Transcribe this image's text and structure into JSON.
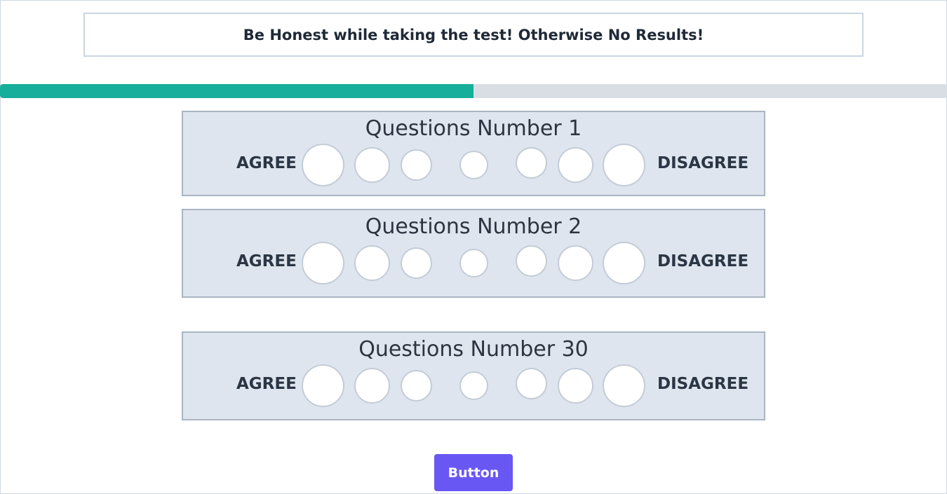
{
  "notice": {
    "text": "Be Honest while taking the test! Otherwise No Results!"
  },
  "progress": {
    "fraction": 0.5,
    "fill_color": "#17ae9b",
    "track_color": "#d9dee5"
  },
  "questions": [
    {
      "title": "Questions Number 1",
      "agree_label": "AGREE",
      "disagree_label": "DISAGREE",
      "options": 7
    },
    {
      "title": "Questions Number 2",
      "agree_label": "AGREE",
      "disagree_label": "DISAGREE",
      "options": 7
    },
    {
      "title": "Questions Number 30",
      "agree_label": "AGREE",
      "disagree_label": "DISAGREE",
      "options": 7
    }
  ],
  "submit": {
    "label": "Button",
    "color": "#6957f4"
  }
}
